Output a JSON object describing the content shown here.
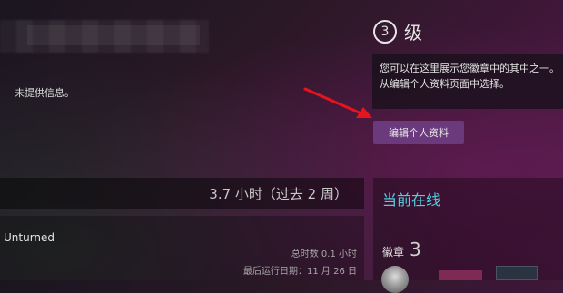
{
  "profile": {
    "info_text": "未提供信息。",
    "level_number": "3",
    "level_label": "级",
    "showcase_line1": "您可以在这里展示您徽章中的其中之一。",
    "showcase_line2": "从编辑个人资料页面中选择。",
    "edit_profile_button": "编辑个人资料"
  },
  "activity": {
    "recent_hours": "3.7 小时（过去 2 周）"
  },
  "game": {
    "name": "Unturned",
    "total_hours": "总时数 0.1 小时",
    "last_played": "最后运行日期：11 月 26 日"
  },
  "status": {
    "online": "当前在线",
    "online_color": "#57cbde"
  },
  "badges": {
    "label": "徽章",
    "count": "3"
  },
  "colors": {
    "button_bg": "#6b3a7d",
    "arrow": "#e8141b"
  }
}
